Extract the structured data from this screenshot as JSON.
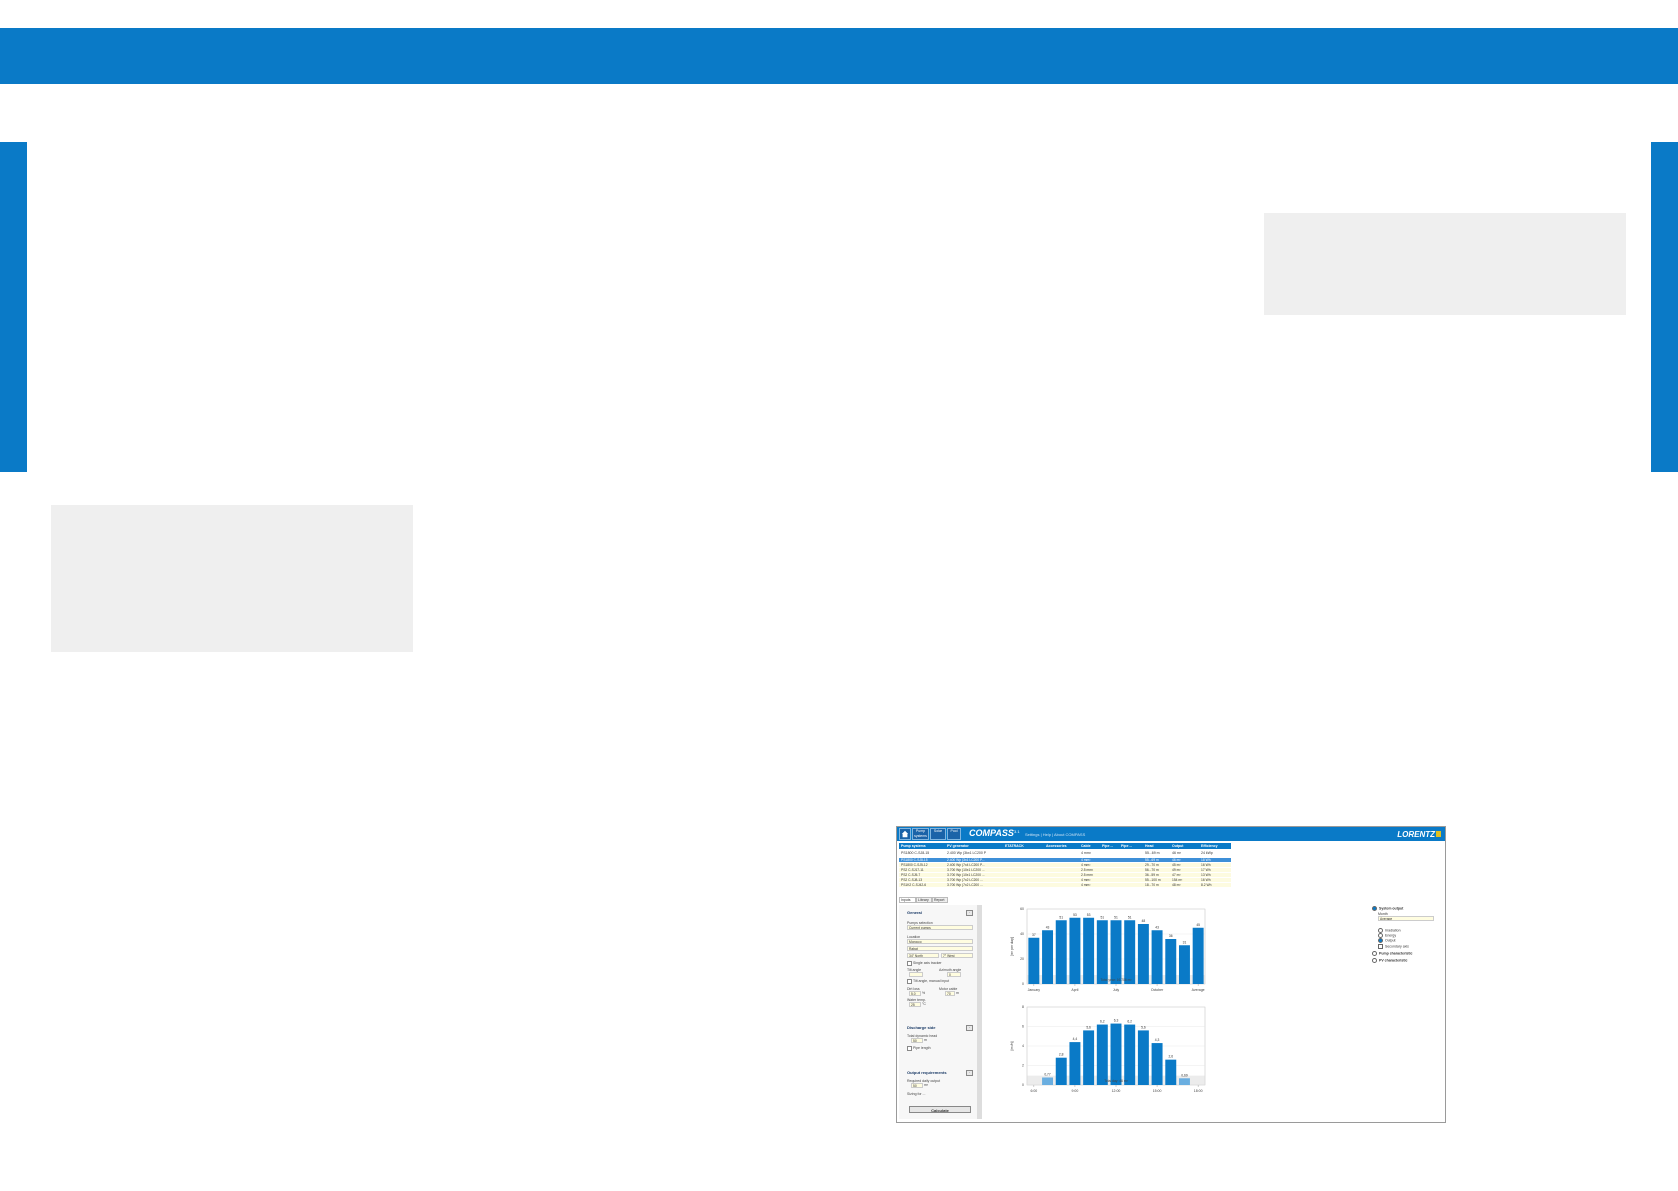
{
  "colors": {
    "brand_blue": "#0a7ac7",
    "grey_box": "#efefef",
    "bar_blue": "#0a7ac7",
    "bar_light": "#6aaee0"
  },
  "app": {
    "header_buttons": [
      "Pump systems",
      "Solar",
      "Pool"
    ],
    "title": "COMPASS",
    "version": "3.1",
    "links": "Settings | Help | About COMPASS",
    "brand": "LORENTZ"
  },
  "table": {
    "columns": [
      "Pump systems",
      "PV generator",
      "ETATRACK",
      "Accessories",
      "Cable",
      "Pipe ...",
      "Pipe ...",
      "Head",
      "Output",
      "Efficiency"
    ],
    "filter": [
      "PS1800 C-SJ8-15",
      "2.400 Wp (3kx1 LC200 P",
      "",
      "",
      "4 mm²",
      "",
      "",
      "55...69 m",
      "46 m³",
      "24 kWp"
    ],
    "rows": [
      {
        "pump": "PS1800 C-SJ8-15",
        "pv": "2.400 Wp (3x1 LC200 P...",
        "cable": "4 mm²",
        "head": "55...69 m",
        "output": "46 m³",
        "eff": "18 Wh"
      },
      {
        "pump": "PS1800 C-SJ5-12",
        "pv": "2.400 Wp (7x4 LC200 P...",
        "cable": "4 mm²",
        "head": "29...70 m",
        "output": "45 m³",
        "eff": "16 Wh"
      },
      {
        "pump": "PS2 C-SJ17-11",
        "pv": "3.700 Wp (10x1 LC200 ...",
        "cable": "2.5 mm²",
        "head": "56...70 m",
        "output": "49 m³",
        "eff": "17 Wh"
      },
      {
        "pump": "PS2 C-SJ5-7",
        "pv": "3.700 Wp (10x1 LC200 ...",
        "cable": "2.5 mm²",
        "head": "36...59 m",
        "output": "47 m³",
        "eff": "13 Wh"
      },
      {
        "pump": "PS2 C-SJ8-13",
        "pv": "3.700 Wp (7x2 LC200 ...",
        "cable": "4 mm²",
        "head": "55...100 m",
        "output": "154 m³",
        "eff": "16 Wh"
      },
      {
        "pump": "PS1K2 C-SJ42-6",
        "pv": "3.700 Wp (7x2 LC200 ...",
        "cable": "4 mm²",
        "head": "18...70 m",
        "output": "48 m³",
        "eff": "8.2 Wh"
      }
    ]
  },
  "tabs": [
    "Inputs",
    "Library",
    "Report"
  ],
  "panel": {
    "general": "General",
    "pump_selection_label": "Pumps selection",
    "pump_selection": "Current pumps",
    "location_label": "Location",
    "location": "Morocco",
    "city": "Rabat",
    "lat": "34° North",
    "lon": "7° West",
    "tracker": "Single axis tracker",
    "tilt_label": "Tilt angle",
    "azimuth_label": "Azimuth angle",
    "tilt_value": "",
    "azimuth_value": "0",
    "manual": "Tilt angle, manual input",
    "dirt_label": "Dirt loss",
    "dirt_value": "5.0",
    "dirt_unit": "%",
    "motor_label": "Motor cable",
    "motor_value": "70",
    "motor_unit": "m",
    "water_label": "Water temp.",
    "water_value": "25",
    "water_unit": "°C",
    "discharge": "Discharge side",
    "tdh_label": "Total dynamic head",
    "tdh_value": "50",
    "tdh_unit": "m",
    "pipe_label": "Pipe length",
    "output": "Output requirements",
    "daily_label": "Required daily output",
    "daily_value": "50",
    "daily_unit": "m³",
    "sizing": "Sizing for ...",
    "calculate": "Calculate"
  },
  "options": {
    "system_output": "System output",
    "month_label": "Month",
    "month_value": "Average",
    "irradiation": "Irradiation",
    "energy": "Energy",
    "output": "Output",
    "secondary": "Secondary axis",
    "pump_char": "Pump characteristic",
    "pv_char": "PV characteristic"
  },
  "chart_data": [
    {
      "type": "bar",
      "categories": [
        "January",
        "February",
        "March",
        "April",
        "May",
        "June",
        "July",
        "August",
        "September",
        "October",
        "November",
        "December",
        "Average"
      ],
      "values": [
        37,
        43,
        51,
        53,
        53,
        51,
        51,
        51,
        48,
        43,
        36,
        31,
        45
      ],
      "value_labels": [
        "37",
        "43",
        "51",
        "53",
        "53",
        "51",
        "51",
        "51",
        "48",
        "43",
        "36",
        "31",
        "45"
      ],
      "tick_labels": [
        "January",
        "April",
        "July",
        "October",
        "Average"
      ],
      "ylabel": "[m³ per day]",
      "ylim": [
        0,
        60
      ],
      "yticks": [
        "0",
        "20",
        "40",
        "60"
      ],
      "annotation": "Total year: 16.706 m³",
      "grid": true
    },
    {
      "type": "bar",
      "categories": [
        "6:00",
        "7:00",
        "8:00",
        "9:00",
        "10:00",
        "11:00",
        "12:00",
        "13:00",
        "14:00",
        "15:00",
        "16:00",
        "17:00",
        "18:00"
      ],
      "values": [
        0,
        0.77,
        2.8,
        4.4,
        5.6,
        6.2,
        6.3,
        6.2,
        5.6,
        4.3,
        2.6,
        0.69,
        0
      ],
      "value_labels": [
        "",
        "0,77",
        "2,8",
        "4,4",
        "5,6",
        "6,2",
        "6,3",
        "6,2",
        "5,6",
        "4,3",
        "2,6",
        "0,69",
        ""
      ],
      "tick_labels": [
        "6:00",
        "9:00",
        "12:00",
        "15:00",
        "18:00"
      ],
      "ylabel": "[m³/h]",
      "ylim": [
        0,
        8
      ],
      "yticks": [
        "0",
        "2",
        "4",
        "6",
        "8"
      ],
      "annotation": "Total day: 46 m³",
      "grid": true
    }
  ]
}
